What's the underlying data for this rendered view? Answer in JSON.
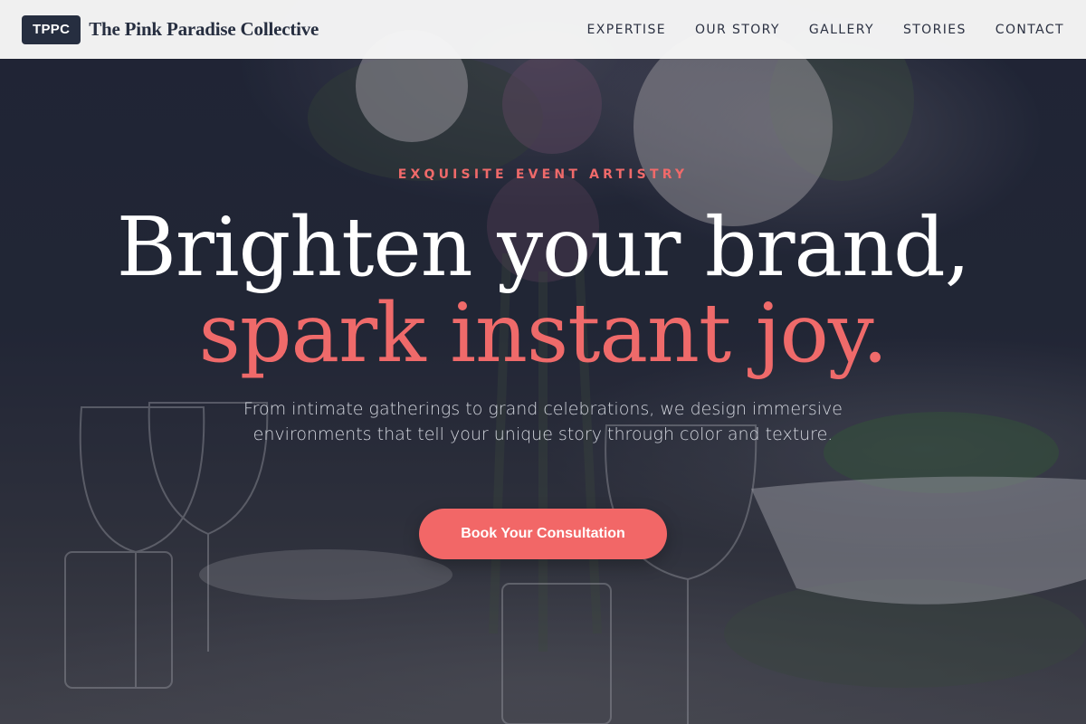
{
  "header": {
    "badge": "TPPC",
    "brand_name": "The Pink Paradise Collective",
    "nav": [
      {
        "label": "EXPERTISE"
      },
      {
        "label": "OUR STORY"
      },
      {
        "label": "GALLERY"
      },
      {
        "label": "STORIES"
      },
      {
        "label": "CONTACT"
      }
    ]
  },
  "hero": {
    "eyebrow": "EXQUISITE EVENT ARTISTRY",
    "headline_line1": "Brighten your brand,",
    "headline_line2": "spark instant joy.",
    "subtext": "From intimate gatherings to grand celebrations, we design immersive environments that tell your unique story through color and texture.",
    "cta_label": "Book Your Consultation"
  },
  "colors": {
    "accent": "#f26767",
    "navy": "#262e40",
    "header_bg": "#f7f7f7"
  }
}
